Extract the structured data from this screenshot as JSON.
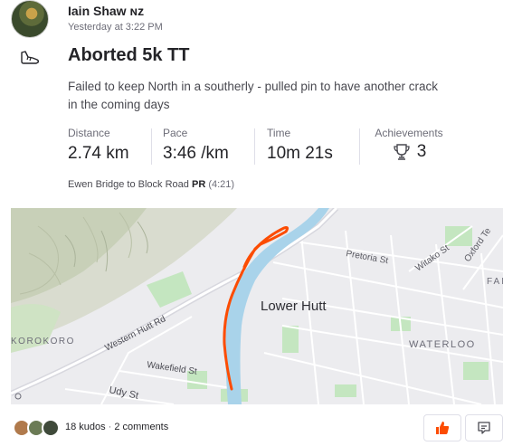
{
  "athlete": {
    "name": "Iain Shaw ɴᴢ",
    "timestamp": "Yesterday at 3:22 PM"
  },
  "activity": {
    "sport_icon": "running-shoe-icon",
    "title": "Aborted 5k TT",
    "description": "Failed to keep North in a southerly - pulled pin to have another crack in the coming days"
  },
  "stats": {
    "distance": {
      "label": "Distance",
      "value": "2.74 km"
    },
    "pace": {
      "label": "Pace",
      "value": "3:46 /km"
    },
    "time": {
      "label": "Time",
      "value": "10m 21s"
    },
    "achievements": {
      "label": "Achievements",
      "value": "3",
      "icon": "trophy-icon"
    }
  },
  "segment": {
    "name": "Ewen Bridge to Block Road",
    "badge": "PR",
    "time": "(4:21)"
  },
  "map": {
    "labels": {
      "lower_hutt": "Lower Hutt",
      "pretoria": "Pretoria St",
      "witako": "Witako St",
      "oxford": "Oxford Te",
      "fai": "FAI",
      "korokoro": "KOROKORO",
      "western_hutt": "Western Hutt Rd",
      "waterloo": "WATERLOO",
      "wakefield": "Wakefield St",
      "udy": "Udy St"
    },
    "route_color": "#fc4c02",
    "river_color": "#a9d3ea",
    "park_color": "#c4e6c0"
  },
  "footer": {
    "kudos": "18 kudos",
    "separator": "·",
    "comments": "2 comments",
    "kudos_icon": "thumbs-up-icon",
    "comment_icon": "comment-icon"
  },
  "colors": {
    "accent": "#fc4c02",
    "text": "#242428",
    "muted": "#6d6d78"
  }
}
